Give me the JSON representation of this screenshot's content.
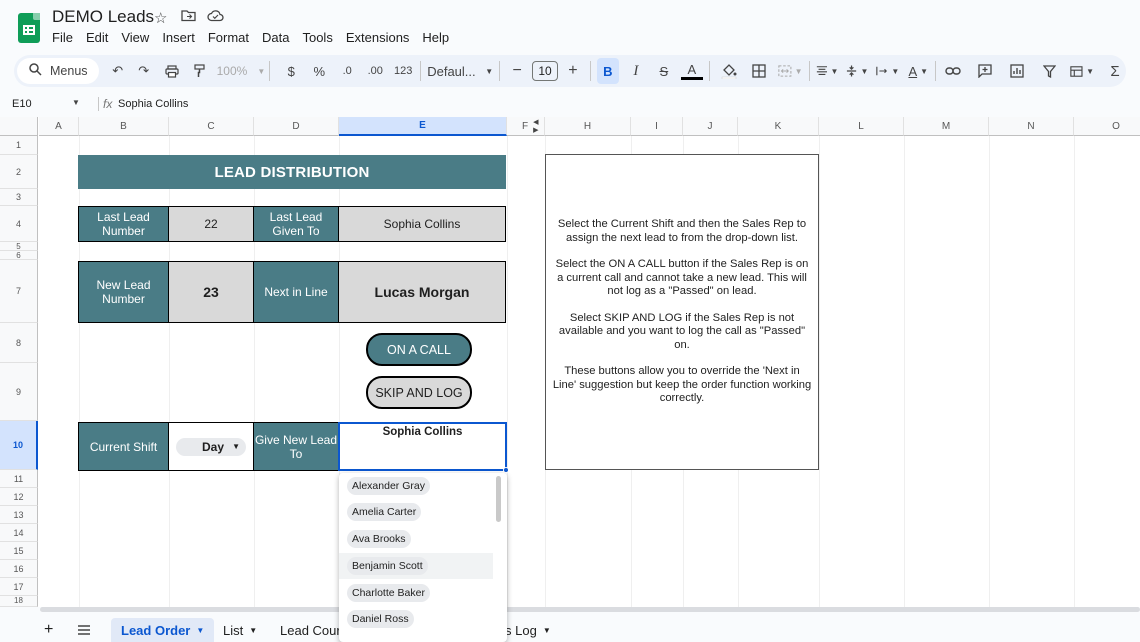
{
  "app": {
    "doc_title": "DEMO Leads",
    "menus": [
      "File",
      "Edit",
      "View",
      "Insert",
      "Format",
      "Data",
      "Tools",
      "Extensions",
      "Help"
    ]
  },
  "toolbar": {
    "search_label": "Menus",
    "zoom": "100%",
    "currency": "$",
    "percent": "%",
    "dec_decrease": ".0",
    "dec_increase": ".00",
    "number_format": "123",
    "font": "Defaul...",
    "font_size": "10",
    "bold": "B",
    "italic": "I"
  },
  "formula_bar": {
    "cell_ref": "E10",
    "fx": "fx",
    "content": "Sophia Collins"
  },
  "columns": [
    "A",
    "B",
    "C",
    "D",
    "E",
    "F",
    "H",
    "I",
    "J",
    "K",
    "L",
    "M",
    "N",
    "O"
  ],
  "rows": [
    "1",
    "2",
    "3",
    "4",
    "5",
    "6",
    "7",
    "8",
    "9",
    "10",
    "11",
    "12",
    "13",
    "14",
    "15",
    "16",
    "17",
    "18"
  ],
  "sheet": {
    "banner": "LEAD DISTRIBUTION",
    "last_lead_label": "Last Lead Number",
    "last_lead_value": "22",
    "last_given_label": "Last Lead Given To",
    "last_given_value": "Sophia Collins",
    "new_lead_label": "New Lead Number",
    "new_lead_value": "23",
    "next_in_line_label": "Next in Line",
    "next_in_line_value": "Lucas Morgan",
    "on_call_button": "ON A CALL",
    "skip_button": "SKIP AND LOG",
    "current_shift_label": "Current Shift",
    "current_shift_value": "Day",
    "give_new_lead_label": "Give New Lead To",
    "give_new_lead_value": "Sophia Collins",
    "notes": [
      "Select the Current Shift and then the Sales Rep to assign the next lead to from the drop-down list.",
      "Select the ON A CALL button if the Sales Rep is on a current call and cannot take a new lead. This will not log as a \"Passed\" on lead.",
      "Select SKIP AND LOG if the Sales Rep is not available and you want to log the call as \"Passed\" on.",
      "These buttons allow you to override the 'Next in Line' suggestion but keep the order function working correctly."
    ]
  },
  "dropdown": {
    "options": [
      "Alexander Gray",
      "Amelia Carter",
      "Ava Brooks",
      "Benjamin Scott",
      "Charlotte Baker",
      "Daniel Ross"
    ],
    "hovered": "Benjamin Scott"
  },
  "tabs": [
    {
      "label": "Lead Order",
      "active": true
    },
    {
      "label": "List",
      "active": false
    },
    {
      "label": "Lead Cour",
      "active": false
    },
    {
      "label": "s Log",
      "active": false
    }
  ],
  "colors": {
    "teal": "#4a7c86",
    "grey_cell": "#d9d9d9",
    "selection_blue": "#0b57d0"
  }
}
